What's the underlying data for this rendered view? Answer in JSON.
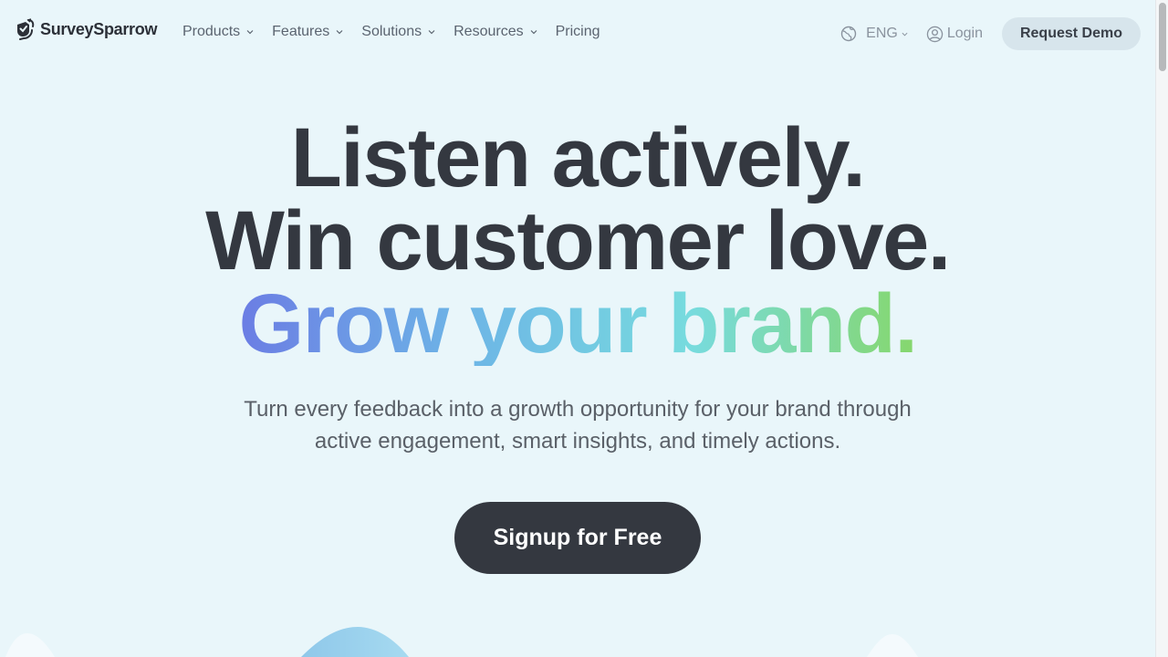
{
  "header": {
    "logo": {
      "text": "SurveySparrow",
      "icon": "sparrow-logo-icon"
    },
    "nav": [
      {
        "label": "Products",
        "has_dropdown": true
      },
      {
        "label": "Features",
        "has_dropdown": true
      },
      {
        "label": "Solutions",
        "has_dropdown": true
      },
      {
        "label": "Resources",
        "has_dropdown": true
      },
      {
        "label": "Pricing",
        "has_dropdown": false
      }
    ],
    "language": {
      "label": "ENG",
      "icon": "globe-icon"
    },
    "login": {
      "label": "Login",
      "icon": "user-circle-icon"
    },
    "demo_button": "Request Demo"
  },
  "hero": {
    "line1": "Listen actively.",
    "line2": "Win customer love.",
    "line3_words": [
      "Grow",
      "your",
      "brand",
      "."
    ],
    "gradient_colors": [
      "#6b7de4",
      "#6db5e6",
      "#77dbde",
      "#86d76c"
    ],
    "subtitle_line1": "Turn every feedback into a growth opportunity for your brand through",
    "subtitle_line2": "active engagement, smart insights, and timely actions.",
    "cta": "Signup for Free"
  },
  "colors": {
    "background": "#e9f6fa",
    "text_dark": "#343840",
    "cta_bg": "#343840",
    "demo_bg": "#d7e5ec"
  }
}
